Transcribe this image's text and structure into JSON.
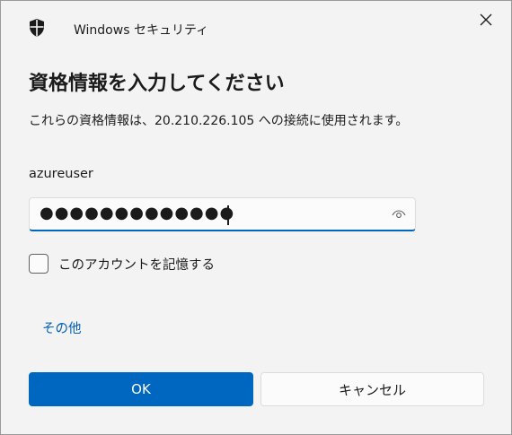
{
  "window": {
    "app_title": "Windows セキュリティ",
    "close_icon": "close-icon",
    "app_icon": "shield-icon"
  },
  "dialog": {
    "heading": "資格情報を入力してください",
    "description": "これらの資格情報は、20.210.226.105 への接続に使用されます。",
    "username": "azureuser",
    "password_masked": "●●●●●●●●●●●●●",
    "reveal_icon": "eye-icon",
    "remember_label": "このアカウントを記憶する",
    "remember_checked": false,
    "more_choices_label": "その他",
    "ok_label": "OK",
    "cancel_label": "キャンセル"
  },
  "colors": {
    "accent": "#0067c0",
    "link": "#005fb8",
    "background": "#f3f3f3"
  }
}
